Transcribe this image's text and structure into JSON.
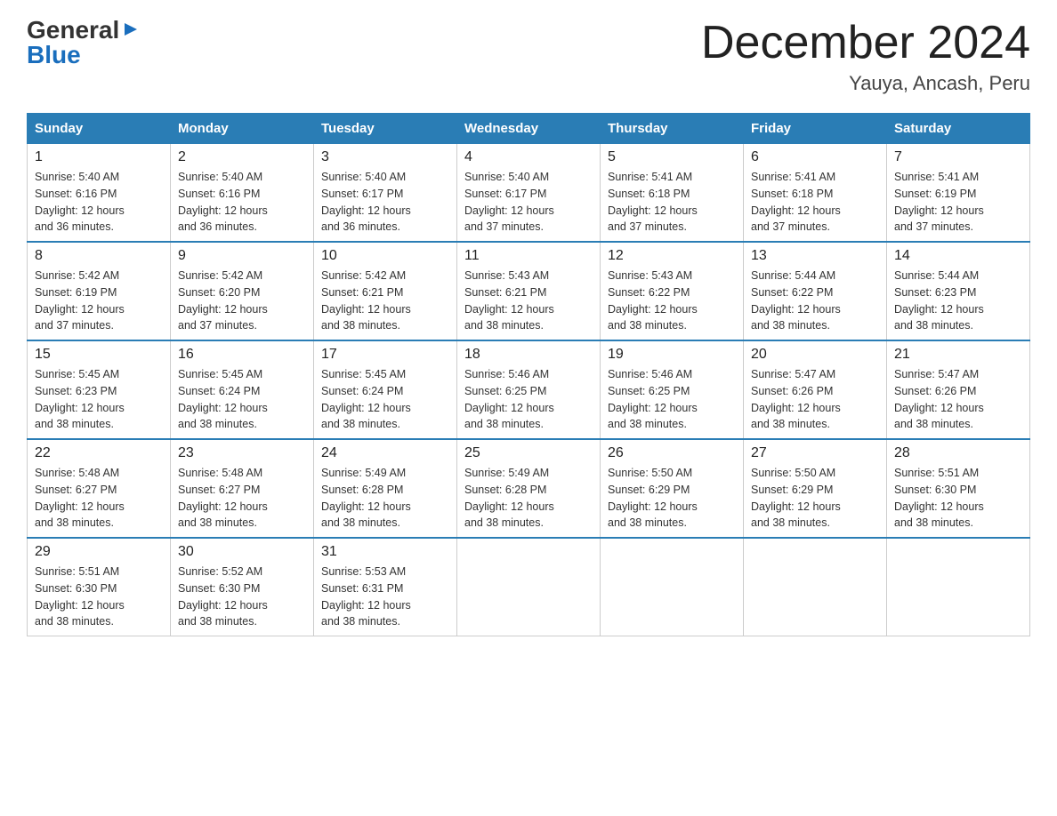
{
  "header": {
    "logo_general": "General",
    "logo_blue": "Blue",
    "title": "December 2024",
    "location": "Yauya, Ancash, Peru"
  },
  "weekdays": [
    "Sunday",
    "Monday",
    "Tuesday",
    "Wednesday",
    "Thursday",
    "Friday",
    "Saturday"
  ],
  "weeks": [
    [
      {
        "day": "1",
        "sunrise": "5:40 AM",
        "sunset": "6:16 PM",
        "daylight": "12 hours and 36 minutes."
      },
      {
        "day": "2",
        "sunrise": "5:40 AM",
        "sunset": "6:16 PM",
        "daylight": "12 hours and 36 minutes."
      },
      {
        "day": "3",
        "sunrise": "5:40 AM",
        "sunset": "6:17 PM",
        "daylight": "12 hours and 36 minutes."
      },
      {
        "day": "4",
        "sunrise": "5:40 AM",
        "sunset": "6:17 PM",
        "daylight": "12 hours and 37 minutes."
      },
      {
        "day": "5",
        "sunrise": "5:41 AM",
        "sunset": "6:18 PM",
        "daylight": "12 hours and 37 minutes."
      },
      {
        "day": "6",
        "sunrise": "5:41 AM",
        "sunset": "6:18 PM",
        "daylight": "12 hours and 37 minutes."
      },
      {
        "day": "7",
        "sunrise": "5:41 AM",
        "sunset": "6:19 PM",
        "daylight": "12 hours and 37 minutes."
      }
    ],
    [
      {
        "day": "8",
        "sunrise": "5:42 AM",
        "sunset": "6:19 PM",
        "daylight": "12 hours and 37 minutes."
      },
      {
        "day": "9",
        "sunrise": "5:42 AM",
        "sunset": "6:20 PM",
        "daylight": "12 hours and 37 minutes."
      },
      {
        "day": "10",
        "sunrise": "5:42 AM",
        "sunset": "6:21 PM",
        "daylight": "12 hours and 38 minutes."
      },
      {
        "day": "11",
        "sunrise": "5:43 AM",
        "sunset": "6:21 PM",
        "daylight": "12 hours and 38 minutes."
      },
      {
        "day": "12",
        "sunrise": "5:43 AM",
        "sunset": "6:22 PM",
        "daylight": "12 hours and 38 minutes."
      },
      {
        "day": "13",
        "sunrise": "5:44 AM",
        "sunset": "6:22 PM",
        "daylight": "12 hours and 38 minutes."
      },
      {
        "day": "14",
        "sunrise": "5:44 AM",
        "sunset": "6:23 PM",
        "daylight": "12 hours and 38 minutes."
      }
    ],
    [
      {
        "day": "15",
        "sunrise": "5:45 AM",
        "sunset": "6:23 PM",
        "daylight": "12 hours and 38 minutes."
      },
      {
        "day": "16",
        "sunrise": "5:45 AM",
        "sunset": "6:24 PM",
        "daylight": "12 hours and 38 minutes."
      },
      {
        "day": "17",
        "sunrise": "5:45 AM",
        "sunset": "6:24 PM",
        "daylight": "12 hours and 38 minutes."
      },
      {
        "day": "18",
        "sunrise": "5:46 AM",
        "sunset": "6:25 PM",
        "daylight": "12 hours and 38 minutes."
      },
      {
        "day": "19",
        "sunrise": "5:46 AM",
        "sunset": "6:25 PM",
        "daylight": "12 hours and 38 minutes."
      },
      {
        "day": "20",
        "sunrise": "5:47 AM",
        "sunset": "6:26 PM",
        "daylight": "12 hours and 38 minutes."
      },
      {
        "day": "21",
        "sunrise": "5:47 AM",
        "sunset": "6:26 PM",
        "daylight": "12 hours and 38 minutes."
      }
    ],
    [
      {
        "day": "22",
        "sunrise": "5:48 AM",
        "sunset": "6:27 PM",
        "daylight": "12 hours and 38 minutes."
      },
      {
        "day": "23",
        "sunrise": "5:48 AM",
        "sunset": "6:27 PM",
        "daylight": "12 hours and 38 minutes."
      },
      {
        "day": "24",
        "sunrise": "5:49 AM",
        "sunset": "6:28 PM",
        "daylight": "12 hours and 38 minutes."
      },
      {
        "day": "25",
        "sunrise": "5:49 AM",
        "sunset": "6:28 PM",
        "daylight": "12 hours and 38 minutes."
      },
      {
        "day": "26",
        "sunrise": "5:50 AM",
        "sunset": "6:29 PM",
        "daylight": "12 hours and 38 minutes."
      },
      {
        "day": "27",
        "sunrise": "5:50 AM",
        "sunset": "6:29 PM",
        "daylight": "12 hours and 38 minutes."
      },
      {
        "day": "28",
        "sunrise": "5:51 AM",
        "sunset": "6:30 PM",
        "daylight": "12 hours and 38 minutes."
      }
    ],
    [
      {
        "day": "29",
        "sunrise": "5:51 AM",
        "sunset": "6:30 PM",
        "daylight": "12 hours and 38 minutes."
      },
      {
        "day": "30",
        "sunrise": "5:52 AM",
        "sunset": "6:30 PM",
        "daylight": "12 hours and 38 minutes."
      },
      {
        "day": "31",
        "sunrise": "5:53 AM",
        "sunset": "6:31 PM",
        "daylight": "12 hours and 38 minutes."
      },
      null,
      null,
      null,
      null
    ]
  ],
  "labels": {
    "sunrise": "Sunrise:",
    "sunset": "Sunset:",
    "daylight": "Daylight:"
  }
}
